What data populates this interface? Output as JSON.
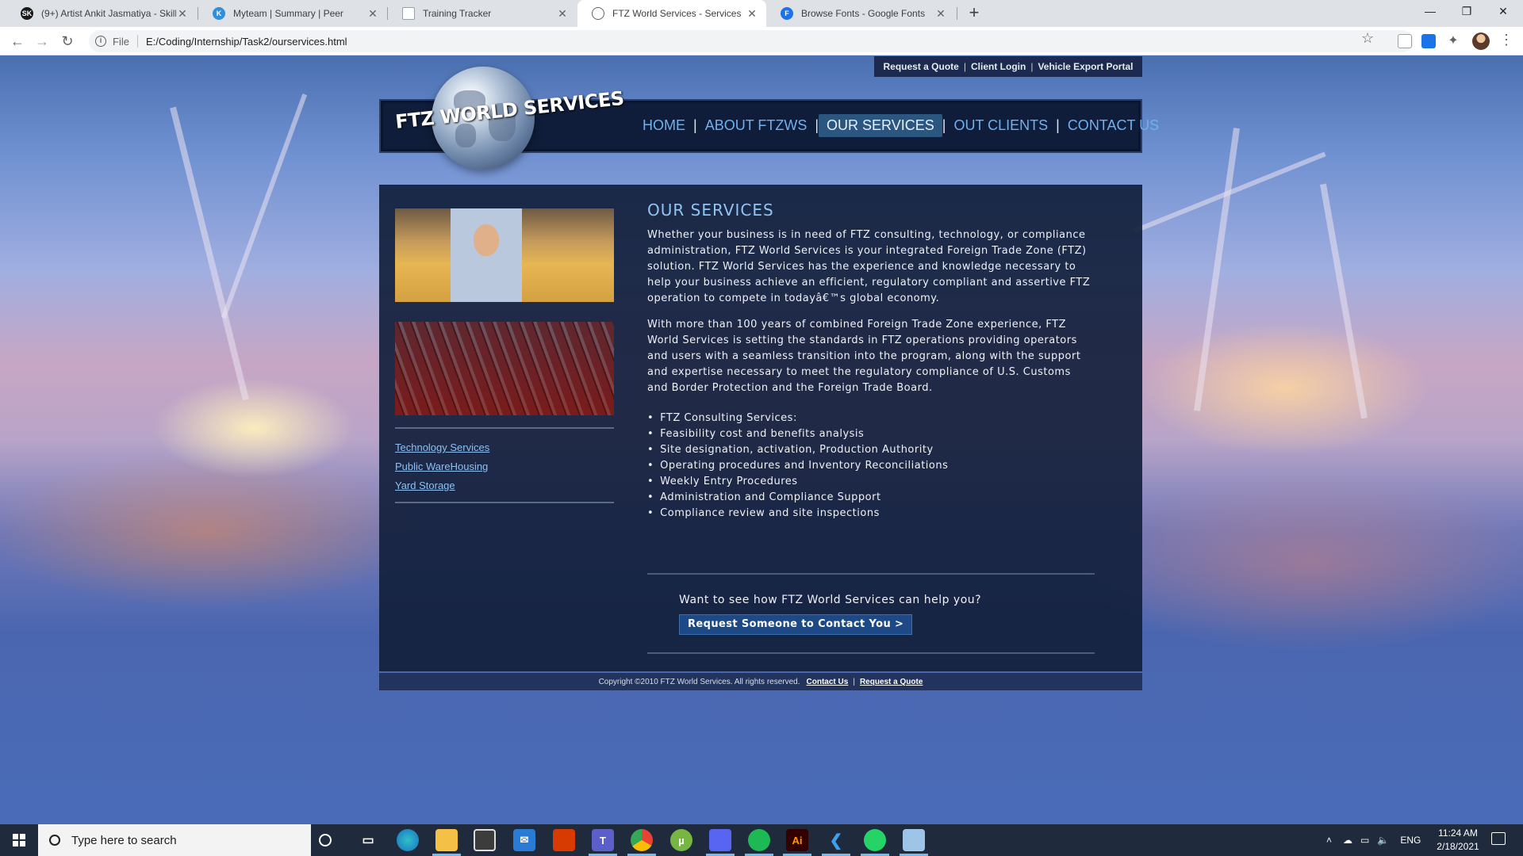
{
  "browser": {
    "tabs": [
      {
        "title": "(9+) Artist Ankit Jasmatiya - Skill",
        "favicon": "sk-favicon",
        "fav_color": "#1a1a1a",
        "fav_text": "SK"
      },
      {
        "title": "Myteam | Summary | Peer",
        "favicon": "k-favicon",
        "fav_color": "#2f8fd8",
        "fav_text": "K"
      },
      {
        "title": "Training Tracker",
        "favicon": "doc-favicon",
        "fav_color": "#9aa0a6",
        "fav_text": ""
      },
      {
        "title": "FTZ World Services - Services",
        "favicon": "globe-favicon",
        "fav_color": "#5f6368",
        "fav_text": ""
      },
      {
        "title": "Browse Fonts - Google Fonts",
        "favicon": "f-favicon",
        "fav_color": "#1a73e8",
        "fav_text": "F"
      }
    ],
    "active_tab": 3,
    "address": {
      "scheme": "File",
      "url": "E:/Coding/Internship/Task2/ourservices.html"
    }
  },
  "site": {
    "util_links": [
      "Request a Quote",
      "Client Login",
      "Vehicle Export Portal"
    ],
    "logo_text": "FTZ WORLD SERVICES",
    "nav": [
      "HOME",
      "ABOUT FTZWS",
      "OUR SERVICES",
      "OUT CLIENTS",
      "CONTACT US"
    ],
    "nav_active": 2,
    "sidebar_links": [
      "Technology Services",
      "Public WareHousing",
      "Yard Storage"
    ],
    "heading": "OUR SERVICES",
    "paragraphs": [
      "Whether your business is in need of FTZ consulting, technology, or compliance administration, FTZ World Services is your integrated Foreign Trade Zone (FTZ) solution. FTZ World Services has the experience and knowledge necessary to help your business achieve an efficient, regulatory compliant and assertive FTZ operation to compete in todayâ€™s global economy.",
      "With more than 100 years of combined Foreign Trade Zone experience, FTZ World Services is setting the standards in FTZ operations providing operators and users with a seamless transition into the program, along with the support and expertise necessary to meet the regulatory compliance of U.S. Customs and Border Protection and the Foreign Trade Board."
    ],
    "services": [
      "FTZ Consulting Services:",
      "Feasibility cost and benefits analysis",
      "Site designation, activation, Production Authority",
      "Operating procedures and Inventory Reconciliations",
      "Weekly Entry Procedures",
      "Administration and Compliance Support",
      "Compliance review and site inspections"
    ],
    "callout_question": "Want to see how FTZ World Services can help you?",
    "callout_button": "Request Someone to Contact You >",
    "footer": {
      "copyright": "Copyright ©2010 FTZ World Services. All rights reserved.",
      "contact": "Contact Us",
      "quote": "Request a Quote"
    }
  },
  "taskbar": {
    "search_placeholder": "Type here to search",
    "lang": "ENG",
    "time": "11:24 AM",
    "date": "2/18/2021",
    "accent": "#76b9ed"
  }
}
